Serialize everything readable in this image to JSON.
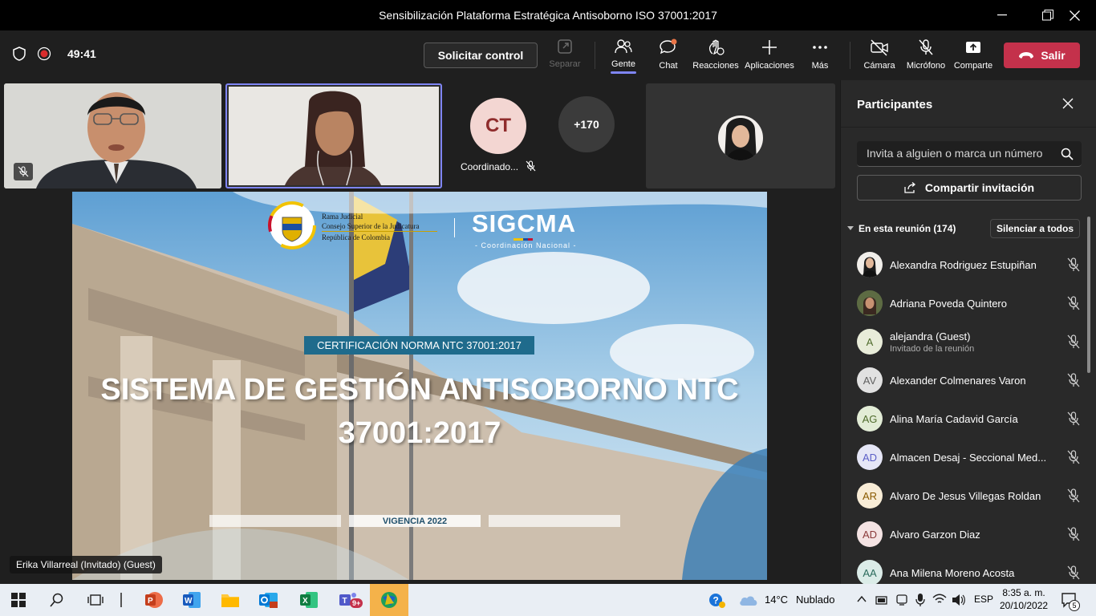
{
  "window": {
    "title": "Sensibilización Plataforma Estratégica Antisoborno ISO 37001:2017"
  },
  "toolbar": {
    "timer": "49:41",
    "request_control": "Solicitar control",
    "items": [
      {
        "label": "Separar",
        "icon": "pop-out-icon"
      },
      {
        "label": "Gente",
        "icon": "people-icon"
      },
      {
        "label": "Chat",
        "icon": "chat-icon"
      },
      {
        "label": "Reacciones",
        "icon": "reactions-icon"
      },
      {
        "label": "Aplicaciones",
        "icon": "apps-plus-icon"
      },
      {
        "label": "Más",
        "icon": "more-icon"
      },
      {
        "label": "Cámara",
        "icon": "camera-off-icon"
      },
      {
        "label": "Micrófono",
        "icon": "mic-off-icon"
      },
      {
        "label": "Comparte",
        "icon": "share-icon"
      }
    ],
    "leave": "Salir",
    "accent": "#7f85f5",
    "leave_color": "#c4314b"
  },
  "gallery": {
    "tile_ct_initials": "CT",
    "tile_ct_name": "Coordinado...",
    "overflow_count": "+170"
  },
  "slide": {
    "org_line1": "Rama Judicial",
    "org_line2": "Consejo Superior de la Judicatura",
    "org_line3": "República de Colombia",
    "brand": "SIGCMA",
    "brand_sub": "- Coordinación Nacional -",
    "badge": "CERTIFICACIÓN NORMA NTC 37001:2017",
    "title_line1": "SISTEMA DE GESTIÓN ANTISOBORNO NTC",
    "title_line2": "37001:2017",
    "footer": "VIGENCIA 2022",
    "presenter": "Erika Villarreal (Invitado) (Guest)"
  },
  "participants": {
    "title": "Participantes",
    "search_placeholder": "Invita a alguien o marca un número",
    "share_invite": "Compartir invitación",
    "section": "En esta reunión (174)",
    "mute_all": "Silenciar a todos",
    "list": [
      {
        "initials": "",
        "name": "Alexandra Rodriguez Estupiñan",
        "sub": "",
        "photo": true
      },
      {
        "initials": "",
        "name": "Adriana Poveda Quintero",
        "sub": "",
        "photo": true
      },
      {
        "initials": "A",
        "name": "alejandra (Guest)",
        "sub": "Invitado de la reunión",
        "photo": false,
        "color": "#4f6b2c"
      },
      {
        "initials": "AV",
        "name": "Alexander Colmenares Varon",
        "sub": "",
        "photo": false,
        "color": "#616161"
      },
      {
        "initials": "AG",
        "name": "Alina María Cadavid García",
        "sub": "",
        "photo": false,
        "color": "#4f6b2c"
      },
      {
        "initials": "AD",
        "name": "Almacen Desaj - Seccional Med...",
        "sub": "",
        "photo": false,
        "color": "#5b5fc7"
      },
      {
        "initials": "AR",
        "name": "Alvaro De Jesus Villegas Roldan",
        "sub": "",
        "photo": false,
        "color": "#8a5a00"
      },
      {
        "initials": "AD",
        "name": "Alvaro Garzon Diaz",
        "sub": "",
        "photo": false,
        "color": "#8b3a3a"
      },
      {
        "initials": "AA",
        "name": "Ana Milena Moreno Acosta",
        "sub": "",
        "photo": false,
        "color": "#2b6b5c"
      }
    ]
  },
  "taskbar": {
    "weather_temp": "14°C",
    "weather_text": "Nublado",
    "lang": "ESP",
    "time": "8:35 a. m.",
    "date": "20/10/2022",
    "notif_count": "5",
    "teams_badge": "9+"
  }
}
